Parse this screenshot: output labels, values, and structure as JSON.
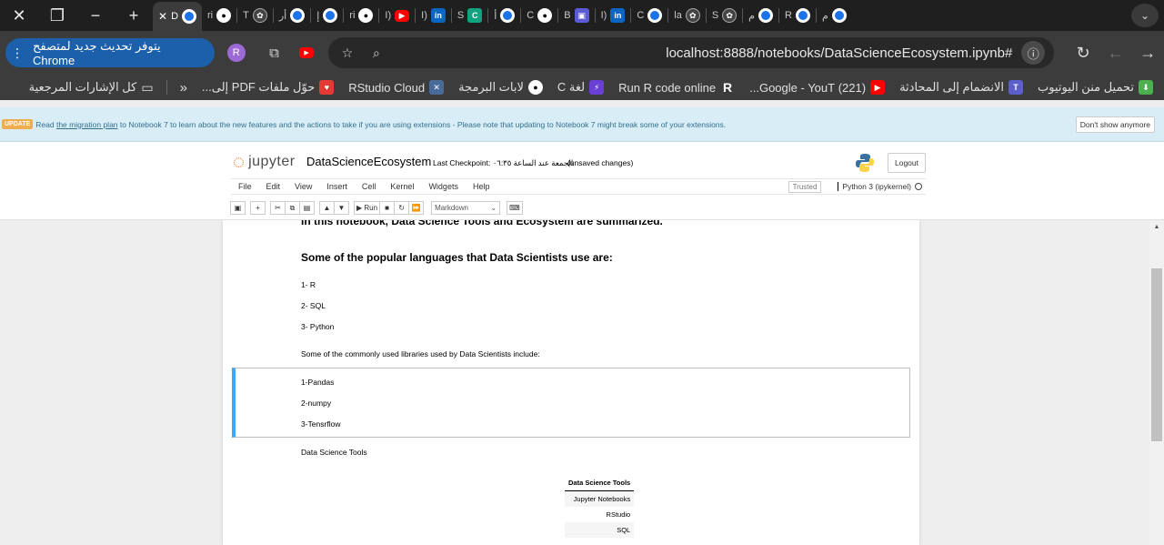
{
  "browser": {
    "tabs": [
      {
        "label": "D",
        "icon": "chrome-icon",
        "active": true
      },
      {
        "label": "ri",
        "icon": "github-icon"
      },
      {
        "label": "T",
        "icon": "openai-icon"
      },
      {
        "label": "أر",
        "icon": "chrome-icon"
      },
      {
        "label": "إ",
        "icon": "chrome-icon"
      },
      {
        "label": "ri",
        "icon": "github-icon"
      },
      {
        "label": "I)",
        "icon": "youtube-icon"
      },
      {
        "label": "I)",
        "icon": "linkedin-icon"
      },
      {
        "label": "S",
        "icon": "chegg-icon"
      },
      {
        "label": "أ",
        "icon": "chrome-icon"
      },
      {
        "label": "C",
        "icon": "github-icon"
      },
      {
        "label": "B",
        "icon": "book-icon"
      },
      {
        "label": "I)",
        "icon": "linkedin-icon"
      },
      {
        "label": "C",
        "icon": "chrome-icon"
      },
      {
        "label": "la",
        "icon": "openai-icon"
      },
      {
        "label": "S",
        "icon": "openai-icon"
      },
      {
        "label": "م",
        "icon": "chrome-icon"
      },
      {
        "label": "R",
        "icon": "chrome-icon"
      },
      {
        "label": "م",
        "icon": "chrome-icon"
      }
    ],
    "update_label": "يتوفر تحديث جديد لمتصفح Chrome",
    "profile_initial": "R",
    "url": "localhost:8888/notebooks/DataScienceEcosystem.ipynb#",
    "bookmarks": [
      {
        "label": "تحميل منن اليوتيوب",
        "icon": "download-icon",
        "color": "#4caf50"
      },
      {
        "label": "الانضمام إلى المحادثة",
        "icon": "teams-icon",
        "color": "#5b5fc7"
      },
      {
        "label": "(221) Google - YouT...",
        "icon": "youtube-icon",
        "color": "#ff0000"
      },
      {
        "label": "Run R code online",
        "icon": "r-icon",
        "color": "#2266bb"
      },
      {
        "label": "لغة C",
        "icon": "bolt-icon",
        "color": "#6a3fd6"
      },
      {
        "label": "لابات البرمجة",
        "icon": "github-icon",
        "color": "#ffffff"
      },
      {
        "label": "RStudio Cloud",
        "icon": "rstudio-icon",
        "color": "#4a6a9a"
      },
      {
        "label": "حوّل ملفات PDF إلى...",
        "icon": "heart-icon",
        "color": "#e53935"
      }
    ],
    "all_bookmarks_label": "كل الإشارات المرجعية"
  },
  "notebook": {
    "banner": {
      "badge": "UPDATE",
      "text_before": "Read ",
      "link": "the migration plan",
      "text_after": " to Notebook 7 to learn about the new features and the actions to take if you are using extensions - Please note that updating to Notebook 7 might break some of your extensions.",
      "dismiss": "Don't show anymore"
    },
    "logo_text": "jupyter",
    "name": "DataScienceEcosystem",
    "checkpoint": "Last Checkpoint: الجمعة عند الساعة ٠٦:٣٥",
    "unsaved": "(unsaved changes)",
    "logout": "Logout",
    "menus": [
      "File",
      "Edit",
      "View",
      "Insert",
      "Cell",
      "Kernel",
      "Widgets",
      "Help"
    ],
    "trusted": "Trusted",
    "kernel": "Python 3 (ipykernel)",
    "run_label": "Run",
    "cell_type": "Markdown"
  },
  "content": {
    "heading_partial": "In this notebook, Data Science Tools and Ecosystem are summarized.",
    "languages_heading": "Some of the popular languages that Data Scientists use are:",
    "languages": [
      "1- R",
      "2- SQL",
      "3- Python"
    ],
    "libraries_intro": "Some of the commonly used libraries used by Data Scientists include:",
    "libraries": [
      "1-Pandas",
      "2-numpy",
      "3-Tensrflow"
    ],
    "tools_label": "Data Science Tools",
    "tools_table": {
      "header": "Data Science Tools",
      "rows": [
        "Jupyter Notebooks",
        "RStudio",
        "SQL"
      ]
    }
  }
}
